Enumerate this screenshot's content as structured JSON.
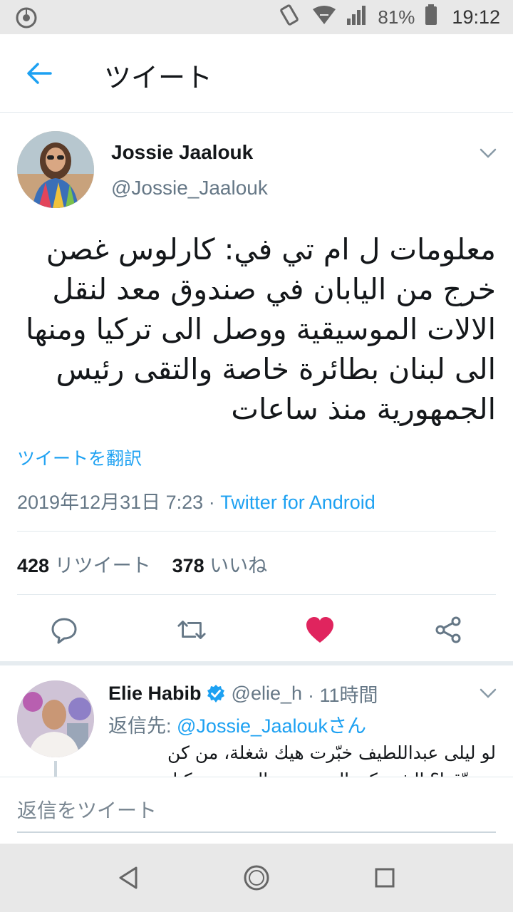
{
  "status_bar": {
    "battery_percent": "81%",
    "time": "19:12",
    "icons": [
      "chrome-icon",
      "vibrate-icon",
      "wifi-icon",
      "signal-icon",
      "battery-icon"
    ]
  },
  "app_bar": {
    "title": "ツイート",
    "back_icon": "arrow-left-icon"
  },
  "tweet": {
    "author_name": "Jossie Jaalouk",
    "author_handle": "@Jossie_Jaalouk",
    "text": "معلومات ل ام تي في: كارلوس غصن خرج من اليابان في صندوق معد لنقل الالات الموسيقية ووصل الى تركيا ومنها الى لبنان بطائرة خاصة والتقى رئيس الجمهورية منذ ساعات",
    "translate_label": "ツイートを翻訳",
    "timestamp": "2019年12月31日 7:23",
    "separator": " · ",
    "source_app": "Twitter for Android",
    "retweet_count": "428",
    "retweet_label": "リツイート",
    "like_count": "378",
    "like_label": "いいね",
    "liked": true
  },
  "reply": {
    "author_name": "Elie Habib",
    "author_handle": "@elie_h",
    "time_ago": "· 11時間",
    "reply_to_label": "返信先: ",
    "reply_to_mention": "@Jossie_Jaaloukさん",
    "text": "لو ليلى عبداللطيف خبّرت هيك شغلة، من كن مصدّقها؟ الشي كرمال عيونهن المبدعة تركيا"
  },
  "composer": {
    "placeholder": "返信をツイート"
  },
  "colors": {
    "accent": "#1da1f2",
    "like": "#e0245e",
    "secondary_text": "#657786"
  }
}
